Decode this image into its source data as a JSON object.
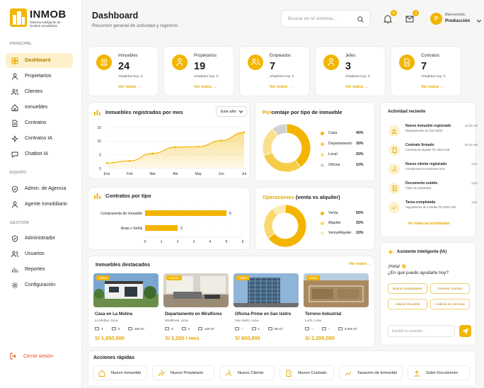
{
  "brand": {
    "name": "INMOB",
    "tagline_1": "Sistema Inteligente de",
    "tagline_2": "Gestión Inmobiliaria"
  },
  "sidebar": {
    "principal_label": "PRINCIPAL",
    "equipo_label": "EQUIPO",
    "gestion_label": "GESTIÓN",
    "principal": [
      {
        "label": "Dashboard",
        "icon": "grid-icon"
      },
      {
        "label": "Propietarios",
        "icon": "user-icon"
      },
      {
        "label": "Clientes",
        "icon": "users-icon"
      },
      {
        "label": "Inmuebles",
        "icon": "home-icon"
      },
      {
        "label": "Contratos",
        "icon": "document-icon"
      },
      {
        "label": "Contratos IA",
        "icon": "sparkle-icon"
      },
      {
        "label": "Chatbot IA",
        "icon": "chat-icon"
      }
    ],
    "equipo": [
      {
        "label": "Admin. de Agencia",
        "icon": "shield-icon"
      },
      {
        "label": "Agente Inmobiliario",
        "icon": "user-icon"
      }
    ],
    "gestion": [
      {
        "label": "Administrador",
        "icon": "shield-icon"
      },
      {
        "label": "Usuarios",
        "icon": "users-icon"
      },
      {
        "label": "Reportes",
        "icon": "bar-chart-icon"
      },
      {
        "label": "Configuración",
        "icon": "gear-icon"
      }
    ],
    "logout": "Cerrar sesión"
  },
  "header": {
    "title": "Dashboard",
    "subtitle": "Resumen general de actividad y registros",
    "search_placeholder": "Buscar en el sistema...",
    "notifications_count": "6",
    "messages_count": "3",
    "user_initial": "P",
    "greeting": "Bienvenido,",
    "user_role": "Producción"
  },
  "stats": [
    {
      "label": "Inmuebles",
      "value": "24",
      "sub": "Añadidos hoy: 0",
      "link": "Ver todos →"
    },
    {
      "label": "Propietarios",
      "value": "19",
      "sub": "Añadidos hoy: 0",
      "link": "Ver todos →"
    },
    {
      "label": "Empleados",
      "value": "7",
      "sub": "Añadidos hoy: 0",
      "link": "Ver todos →"
    },
    {
      "label": "Jefes",
      "value": "3",
      "sub": "Añadidos hoy: 0",
      "link": "Ver todos →"
    },
    {
      "label": "Contratos",
      "value": "7",
      "sub": "Añadidos hoy: 0",
      "link": "Ver todos →"
    }
  ],
  "charts": {
    "line_title": "Inmuebles registrados por mes",
    "line_filter": "Este año",
    "bar_title": "Contratos por tipo",
    "donut1_title_a": "Por",
    "donut1_title_b": "centaje por tipo de inmueble",
    "donut2_title_a": "Operaciones",
    "donut2_title_b": " (venta vs alquiler)"
  },
  "chart_data": [
    {
      "type": "area",
      "title": "Inmuebles registrados por mes",
      "x": [
        "Ene",
        "Feb",
        "Mar",
        "Abr",
        "May",
        "Jun",
        "Jul"
      ],
      "values": [
        2.0,
        2.8,
        5.5,
        7.8,
        8.0,
        10.2,
        13.2
      ],
      "ylim": [
        0,
        15
      ],
      "yticks": [
        0,
        5,
        10,
        15
      ]
    },
    {
      "type": "bar",
      "orientation": "horizontal",
      "title": "Contratos por tipo",
      "categories": [
        "Compraventa de Inmueble",
        "Arras o Señal"
      ],
      "values": [
        5,
        2
      ],
      "xlim": [
        0,
        6
      ],
      "xticks": [
        0,
        1,
        2,
        3,
        4,
        5,
        6
      ]
    },
    {
      "type": "pie",
      "title": "Porcentaje por tipo de inmueble",
      "labels": [
        "Casa",
        "Departamento",
        "Local",
        "Oficina"
      ],
      "values": [
        40,
        30,
        20,
        10
      ],
      "display": [
        "40%",
        "30%",
        "20%",
        "10%"
      ],
      "colors": [
        "#f3b500",
        "#f7cc4a",
        "#fae08e",
        "#d2d2d2"
      ]
    },
    {
      "type": "pie",
      "title": "Operaciones (venta vs alquiler)",
      "labels": [
        "Venta",
        "Alquiler",
        "Venta/Alquiler"
      ],
      "values": [
        65,
        25,
        10
      ],
      "display": [
        "65%",
        "25%",
        "10%"
      ],
      "colors": [
        "#f3b500",
        "#fad86d",
        "#fdeab4"
      ]
    }
  ],
  "activity": {
    "title": "Actividad reciente",
    "link": "Ver todas las actividades",
    "items": [
      {
        "title": "Nuevo inmueble registrado",
        "sub": "Departamento en San Isidro",
        "time": "10:30 AM"
      },
      {
        "title": "Contrato firmado",
        "sub": "Contrato de alquiler #C-2024-128",
        "time": "09:15 AM"
      },
      {
        "title": "Nuevo cliente registrado",
        "sub": "Constructora Inversiones SAC",
        "time": "Ayer"
      },
      {
        "title": "Documento subido",
        "sub": "Título de propiedad",
        "time": "Ayer"
      },
      {
        "title": "Tarea completada",
        "sub": "Seguimiento de contrato #C-2024-125",
        "time": "Ayer"
      }
    ]
  },
  "assistant": {
    "title": "Asistente Inteligente (IA)",
    "hello": "¡Hola! 👋",
    "question": "¿En qué puedo ayudarte hoy?",
    "chips": [
      "Buscar propiedades",
      "Generar contrato",
      "Valorar inmueble",
      "Análisis de mercado"
    ],
    "placeholder": "Escribe tu consulta..."
  },
  "featured": {
    "title": "Inmuebles destacados",
    "link": "Ver todos →",
    "items": [
      {
        "tag": "Venta",
        "name": "Casa en La Molina",
        "loc": "La Molina, Lima",
        "beds": "4",
        "baths": "3",
        "area": "250 m²",
        "price": "S/ 1,650,000"
      },
      {
        "tag": "Alquiler",
        "name": "Departamento en Miraflores",
        "loc": "Miraflores, Lima",
        "beds": "3",
        "baths": "2",
        "area": "120 m²",
        "price": "S/ 3,200 / mes"
      },
      {
        "tag": "Venta",
        "name": "Oficina Prime en San Isidro",
        "loc": "San Isidro, Lima",
        "beds": "–",
        "baths": "1",
        "area": "80 m²",
        "price": "S/ 800,000"
      },
      {
        "tag": "Venta",
        "name": "Terreno Industrial",
        "loc": "Lurín, Lima",
        "beds": "–",
        "baths": "–",
        "area": "5,000 m²",
        "price": "S/ 2,200,000"
      }
    ]
  },
  "quick": {
    "title": "Acciones rápidas",
    "items": [
      "Nuevo Inmueble",
      "Nuevo Propietario",
      "Nuevo Cliente",
      "Nuevo Contrato",
      "Tasación de Inmueble",
      "Subir Documento"
    ]
  }
}
